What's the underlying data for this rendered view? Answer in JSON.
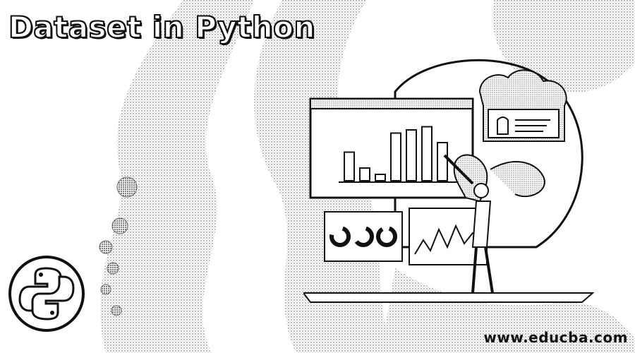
{
  "title": "Dataset in Python",
  "watermark": "www.educba.com",
  "logo": {
    "icon": "python-logo-icon"
  },
  "illustration": {
    "icon": "data-dashboard-illustration",
    "bar_levels": [
      0.45,
      0.2,
      0.1,
      0.75,
      0.8,
      0.85,
      0.6
    ]
  },
  "colors": {
    "background": "#ffffff",
    "ink": "#111111",
    "stipple": "#9a9a9a"
  }
}
